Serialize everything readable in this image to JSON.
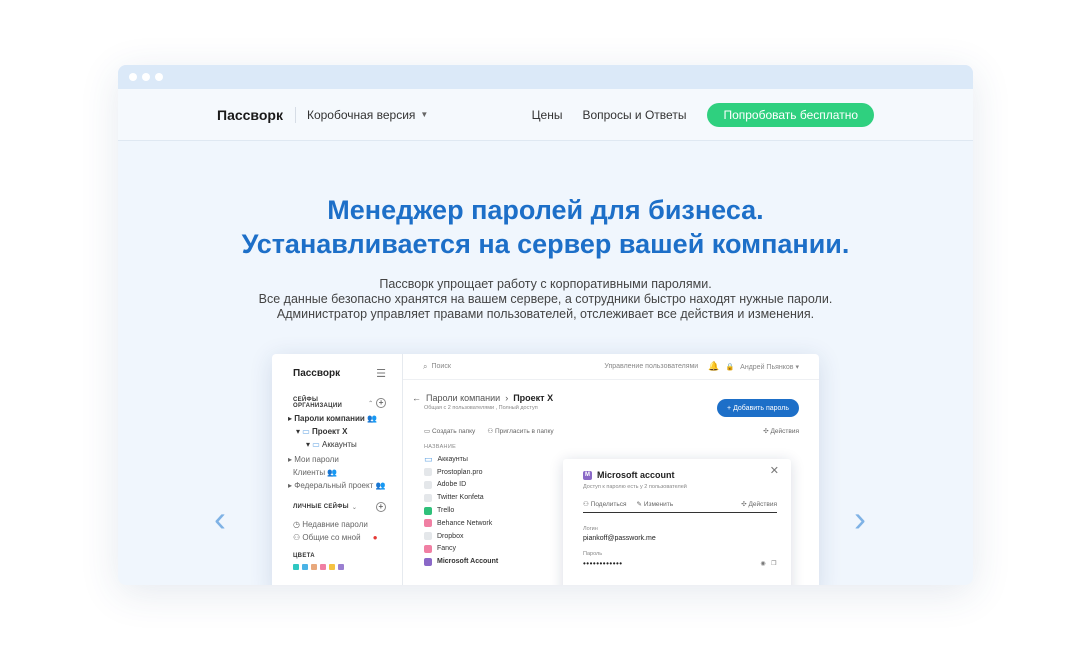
{
  "nav": {
    "logo": "Пассворк",
    "version": "Коробочная версия",
    "links": [
      "Цены",
      "Вопросы и Ответы"
    ],
    "cta": "Попробовать бесплатно"
  },
  "hero": {
    "title_line1": "Менеджер паролей для бизнеса.",
    "title_line2": "Устанавливается на сервер вашей компании.",
    "lead": [
      "Пассворк упрощает работу с корпоративными паролями.",
      "Все данные безопасно хранятся на вашем сервере, а сотрудники быстро находят нужные пароли.",
      "Администратор управляет правами пользователей, отслеживает все действия и изменения."
    ]
  },
  "carousel": {
    "prev": "‹",
    "next": "›"
  },
  "app": {
    "logo": "Пассворк",
    "search_placeholder": "Поиск",
    "user_mgmt": "Управление пользователями",
    "user_name": "Андрей Пьянков",
    "sidebar": {
      "org_safes": "СЕЙФЫ ОРГАНИЗАЦИИ",
      "company_passwords": "Пароли компании",
      "project_x": "Проект X",
      "accounts": "Аккаунты",
      "my_passwords": "Мои пароли",
      "clients": "Клиенты",
      "federal": "Федеральный проект",
      "personal_safes": "ЛИЧНЫЕ СЕЙФЫ",
      "recent": "Недавние пароли",
      "shared": "Общие со мной",
      "colors_label": "ЦВЕТА",
      "colors": [
        "#2fc7c1",
        "#4ab3e6",
        "#e8a87c",
        "#f07fa3",
        "#f5c242",
        "#9a7fd1"
      ]
    },
    "breadcrumb": {
      "parent": "Пароли компании",
      "current": "Проект X",
      "sub": "Общая с 2 пользователями , Полный доступ"
    },
    "add_password": "Добавить пароль",
    "tools": {
      "create_folder": "Создать папку",
      "invite": "Пригласить в папку",
      "actions": "Действия"
    },
    "column_name": "НАЗВАНИЕ",
    "files": [
      {
        "name": "Аккаунты",
        "color": "folder"
      },
      {
        "name": "Prostoplan.pro",
        "color": "#e4e7ea"
      },
      {
        "name": "Adobe ID",
        "color": "#e4e7ea"
      },
      {
        "name": "Twitter Konfeta",
        "color": "#e4e7ea"
      },
      {
        "name": "Trello",
        "color": "#2fc07a"
      },
      {
        "name": "Behance Network",
        "color": "#f07fa3"
      },
      {
        "name": "Dropbox",
        "color": "#e4e7ea"
      },
      {
        "name": "Fancy",
        "color": "#f07fa3"
      },
      {
        "name": "Microsoft Account",
        "color": "#8a68c7"
      }
    ],
    "panel": {
      "title": "Microsoft account",
      "icon_letter": "M",
      "sub": "Доступ к паролю есть у 2 пользователей",
      "share": "Поделиться",
      "edit": "Изменить",
      "actions": "Действия",
      "login_label": "Логин",
      "login_value": "piankoff@passwork.me",
      "password_label": "Пароль",
      "password_value": "••••••••••••"
    }
  }
}
